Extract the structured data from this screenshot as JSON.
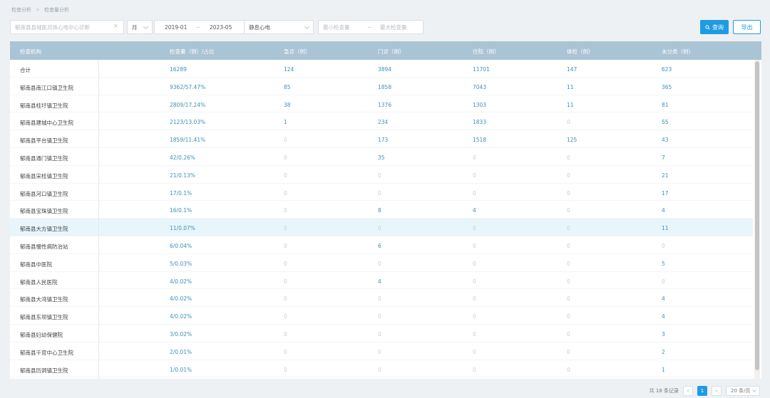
{
  "breadcrumb": [
    "检查分析",
    "检查量分析"
  ],
  "filters": {
    "institution_placeholder": "郁南县县域医共体心电中心诊断",
    "period": "月",
    "date_start": "2019-01",
    "date_sep": "~",
    "date_end": "2023-05",
    "category": "静息心电",
    "min_placeholder": "最小检查量",
    "range_sep": "~",
    "max_placeholder": "最大检查量"
  },
  "buttons": {
    "query": "查询",
    "export": "导出"
  },
  "table": {
    "headers": [
      "检查机构",
      "检查量（例）/占比",
      "急诊（例）",
      "门诊（例）",
      "住院（例）",
      "体检（例）",
      "未分类（例）"
    ],
    "rows": [
      [
        "合计",
        "16289",
        "124",
        "3894",
        "11701",
        "147",
        "623"
      ],
      [
        "郁南县南江口镇卫生院",
        "9362/57.47%",
        "85",
        "1858",
        "7043",
        "11",
        "365"
      ],
      [
        "郁南县桂圩镇卫生院",
        "2809/17.24%",
        "38",
        "1376",
        "1303",
        "11",
        "81"
      ],
      [
        "郁南县建城中心卫生院",
        "2123/13.03%",
        "1",
        "234",
        "1833",
        "0",
        "55"
      ],
      [
        "郁南县平台镇卫生院",
        "1859/11.41%",
        "0",
        "173",
        "1518",
        "125",
        "43"
      ],
      [
        "郁南县通门镇卫生院",
        "42/0.26%",
        "0",
        "35",
        "0",
        "0",
        "7"
      ],
      [
        "郁南县宋桂镇卫生院",
        "21/0.13%",
        "0",
        "0",
        "0",
        "0",
        "21"
      ],
      [
        "郁南县河口镇卫生院",
        "17/0.1%",
        "0",
        "0",
        "0",
        "0",
        "17"
      ],
      [
        "郁南县宝珠镇卫生院",
        "16/0.1%",
        "0",
        "8",
        "4",
        "0",
        "4"
      ],
      [
        "郁南县大方镇卫生院",
        "11/0.07%",
        "0",
        "0",
        "0",
        "0",
        "11"
      ],
      [
        "郁南县慢性病防治站",
        "6/0.04%",
        "0",
        "6",
        "0",
        "0",
        "0"
      ],
      [
        "郁南县中医院",
        "5/0.03%",
        "0",
        "0",
        "0",
        "0",
        "5"
      ],
      [
        "郁南县人民医院",
        "4/0.02%",
        "0",
        "4",
        "0",
        "0",
        "0"
      ],
      [
        "郁南县大湾镇卫生院",
        "4/0.02%",
        "0",
        "0",
        "0",
        "0",
        "4"
      ],
      [
        "郁南县东坝镇卫生院",
        "4/0.02%",
        "0",
        "0",
        "0",
        "0",
        "4"
      ],
      [
        "郁南县妇幼保健院",
        "3/0.02%",
        "0",
        "0",
        "0",
        "0",
        "3"
      ],
      [
        "郁南县千官中心卫生院",
        "2/0.01%",
        "0",
        "0",
        "0",
        "0",
        "2"
      ],
      [
        "郁南县历洞镇卫生院",
        "1/0.01%",
        "0",
        "0",
        "0",
        "0",
        "1"
      ]
    ],
    "highlight_row": 9
  },
  "pagination": {
    "total": "共 18 条记录",
    "prev": "<",
    "page": "1",
    "next": ">",
    "page_size": "20 条/页"
  },
  "colors": {
    "primary": "#1e9be3",
    "header_bg": "#a9c4d4",
    "highlight": "#e8f6fb"
  }
}
